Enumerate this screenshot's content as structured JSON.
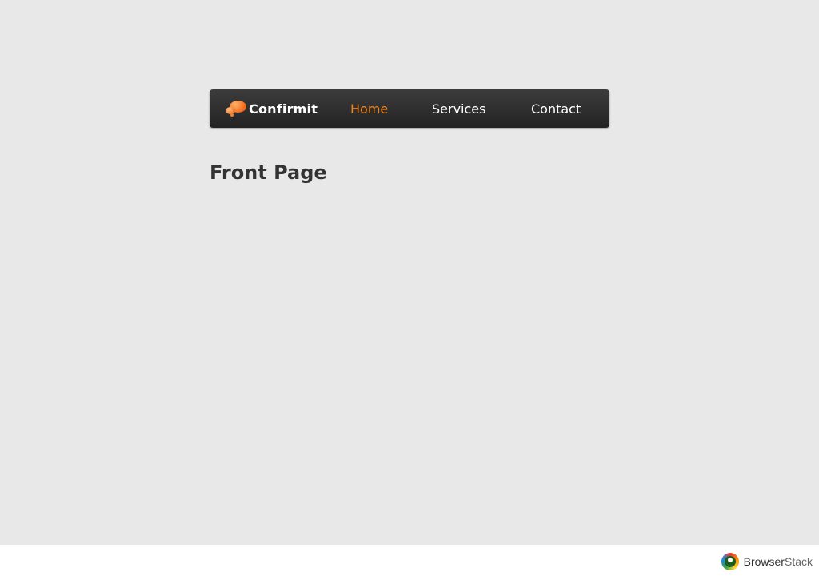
{
  "nav": {
    "logo_text": "Confirmit",
    "logo_icon": "speech-bubbles-logo",
    "items": [
      {
        "label": "Home",
        "active": true
      },
      {
        "label": "Services",
        "active": false
      },
      {
        "label": "Contact",
        "active": false
      }
    ]
  },
  "page": {
    "title": "Front Page"
  },
  "footer": {
    "brand_bold": "Browser",
    "brand_light": "Stack",
    "brand_icon": "browserstack-logo"
  },
  "colors": {
    "background": "#e8e8e8",
    "navbar": "#2e2e2e",
    "active_link": "#f0831e",
    "link": "#ffffff",
    "title": "#333333"
  }
}
